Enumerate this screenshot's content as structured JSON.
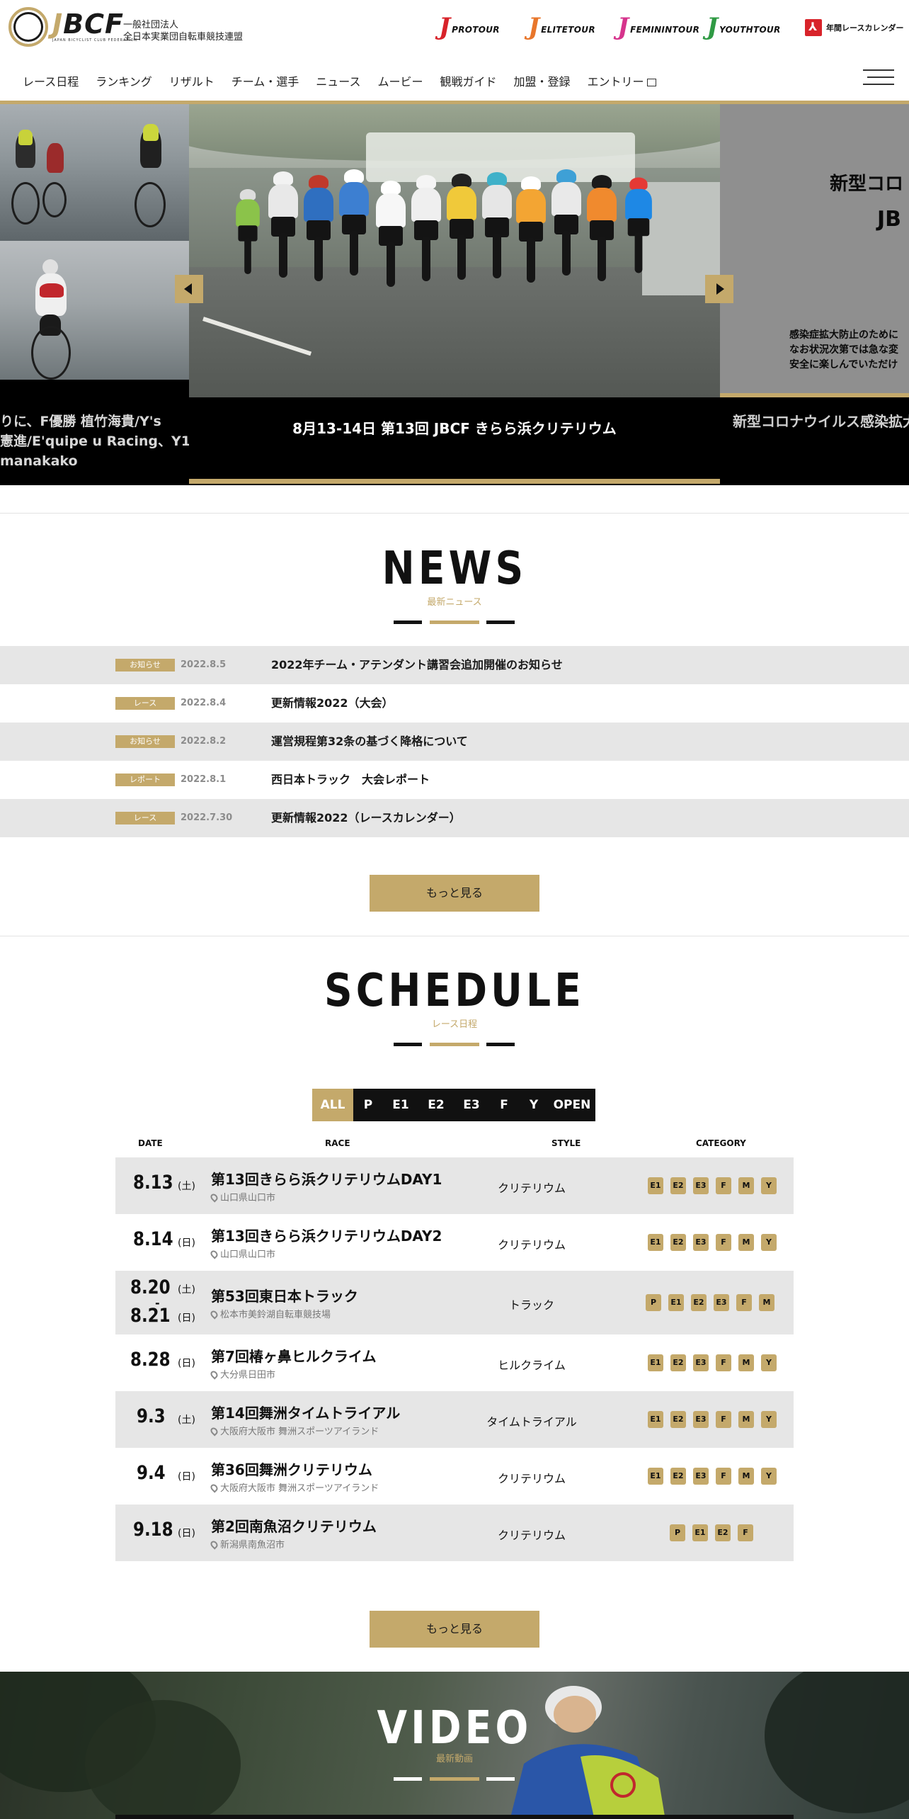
{
  "header": {
    "logo_text": "JBCF",
    "logo_subtext": "JAPAN BICYCLIST CLUB FEDERATION",
    "org_line1": "一般社団法人",
    "org_line2": "全日本実業団自転車競技連盟",
    "tours": [
      {
        "j": "J",
        "name": "PROTOUR",
        "color": "#d8232a"
      },
      {
        "j": "J",
        "name": "ELITETOUR",
        "color": "#e8762b"
      },
      {
        "j": "J",
        "name": "FEMININTOUR",
        "color": "#d6338c"
      },
      {
        "j": "J",
        "name": "YOUTHTOUR",
        "color": "#2f9a44"
      }
    ],
    "calendar_pdf_label": "年間レースカレンダー",
    "nav": [
      "レース日程",
      "ランキング",
      "リザルト",
      "チーム・選手",
      "ニュース",
      "ムービー",
      "観戦ガイド",
      "加盟・登録",
      "エントリー"
    ]
  },
  "hero": {
    "left_caption_lines": [
      "りに、F優勝 植竹海貴/Y's",
      "憲進/E'quipe u Racing、Y1",
      "manakako"
    ],
    "center_caption": "8月13-14日 第13回 JBCF きらら浜クリテリウム",
    "right_title_line1": "新型コロ",
    "right_title_line2": "JB",
    "right_body": [
      "感染症拡大防止のために",
      "なお状況次第では急な変",
      "安全に楽しんでいただけ"
    ],
    "right_caption": "新型コロナウイルス感染拡大"
  },
  "news": {
    "title": "NEWS",
    "subtitle": "最新ニュース",
    "items": [
      {
        "tag": "お知らせ",
        "date": "2022.8.5",
        "title": "2022年チーム・アテンダント講習会追加開催のお知らせ"
      },
      {
        "tag": "レース",
        "date": "2022.8.4",
        "title": "更新情報2022（大会）"
      },
      {
        "tag": "お知らせ",
        "date": "2022.8.2",
        "title": "運営規程第32条の基づく降格について"
      },
      {
        "tag": "レポート",
        "date": "2022.8.1",
        "title": "西日本トラック　大会レポート"
      },
      {
        "tag": "レース",
        "date": "2022.7.30",
        "title": "更新情報2022（レースカレンダー）"
      }
    ],
    "more_label": "もっと見る"
  },
  "schedule": {
    "title": "SCHEDULE",
    "subtitle": "レース日程",
    "filters": [
      "ALL",
      "P",
      "E1",
      "E2",
      "E3",
      "F",
      "Y",
      "OPEN"
    ],
    "active_filter": "ALL",
    "headers": {
      "date": "DATE",
      "race": "RACE",
      "style": "STYLE",
      "category": "CATEGORY"
    },
    "rows": [
      {
        "date": "8.13",
        "dow": "(土)",
        "name": "第13回きらら浜クリテリウムDAY1",
        "place": "山口県山口市",
        "style": "クリテリウム",
        "cats": [
          "E1",
          "E2",
          "E3",
          "F",
          "M",
          "Y"
        ]
      },
      {
        "date": "8.14",
        "dow": "(日)",
        "name": "第13回きらら浜クリテリウムDAY2",
        "place": "山口県山口市",
        "style": "クリテリウム",
        "cats": [
          "E1",
          "E2",
          "E3",
          "F",
          "M",
          "Y"
        ]
      },
      {
        "date": "8.20",
        "dow": "(土)",
        "date2": "8.21",
        "dow2": "(日)",
        "name": "第53回東日本トラック",
        "place": "松本市美鈴湖自転車競技場",
        "style": "トラック",
        "cats": [
          "P",
          "E1",
          "E2",
          "E3",
          "F",
          "M"
        ]
      },
      {
        "date": "8.28",
        "dow": "(日)",
        "name": "第7回椿ヶ鼻ヒルクライム",
        "place": "大分県日田市",
        "style": "ヒルクライム",
        "cats": [
          "E1",
          "E2",
          "E3",
          "F",
          "M",
          "Y"
        ]
      },
      {
        "date": "9.3",
        "dow": "(土)",
        "name": "第14回舞洲タイムトライアル",
        "place": "大阪府大阪市 舞洲スポーツアイランド",
        "style": "タイムトライアル",
        "cats": [
          "E1",
          "E2",
          "E3",
          "F",
          "M",
          "Y"
        ]
      },
      {
        "date": "9.4",
        "dow": "(日)",
        "name": "第36回舞洲クリテリウム",
        "place": "大阪府大阪市 舞洲スポーツアイランド",
        "style": "クリテリウム",
        "cats": [
          "E1",
          "E2",
          "E3",
          "F",
          "M",
          "Y"
        ]
      },
      {
        "date": "9.18",
        "dow": "(日)",
        "name": "第2回南魚沼クリテリウム",
        "place": "新潟県南魚沼市",
        "style": "クリテリウム",
        "cats": [
          "P",
          "E1",
          "E2",
          "F"
        ]
      }
    ],
    "more_label": "もっと見る"
  },
  "video": {
    "title": "VIDEO",
    "subtitle": "最新動画"
  },
  "colors": {
    "accent_gold": "#c4a96b",
    "dark": "#111111",
    "row_shade": "#e6e6e6"
  }
}
